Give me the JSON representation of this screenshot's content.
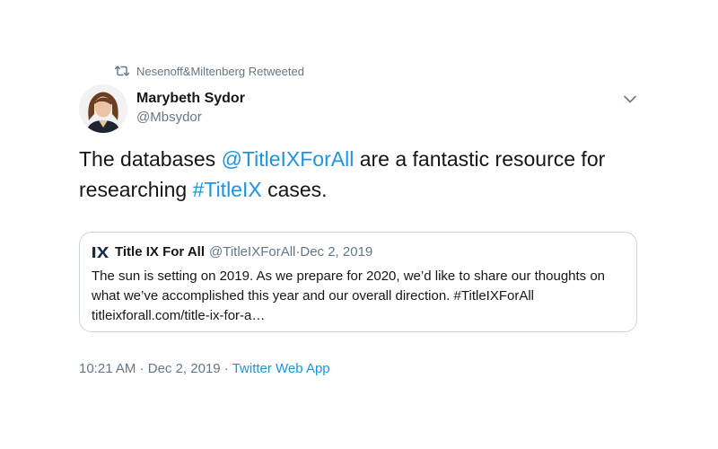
{
  "retweet": {
    "label": "Nesenoff&Miltenberg Retweeted"
  },
  "author": {
    "display_name": "Marybeth Sydor",
    "handle": "@Mbsydor"
  },
  "tweet": {
    "text_part1": "The databases ",
    "mention": "@TitleIXForAll",
    "text_part2": " are a fantastic resource for researching ",
    "hashtag": "#TitleIX",
    "text_part3": " cases."
  },
  "quote": {
    "name": "Title IX For All",
    "handle": "@TitleIXForAll",
    "separator": " · ",
    "date": "Dec 2, 2019",
    "text": "The sun is setting on 2019. As we prepare for 2020, we’d like to share our thoughts on what we’ve accomplished this year and our overall direction. #TitleIXForAll titleixforall.com/title-ix-for-a…"
  },
  "footer": {
    "time": "10:21 AM",
    "separator": " · ",
    "date": "Dec 2, 2019",
    "source": "Twitter Web App"
  },
  "colors": {
    "link": "#1b95e0",
    "secondary_text": "#657786",
    "border": "#ccd6dd"
  },
  "icons": {
    "retweet": "retweet-icon",
    "caret": "chevron-down-icon",
    "quote_logo": "ix-logo"
  }
}
